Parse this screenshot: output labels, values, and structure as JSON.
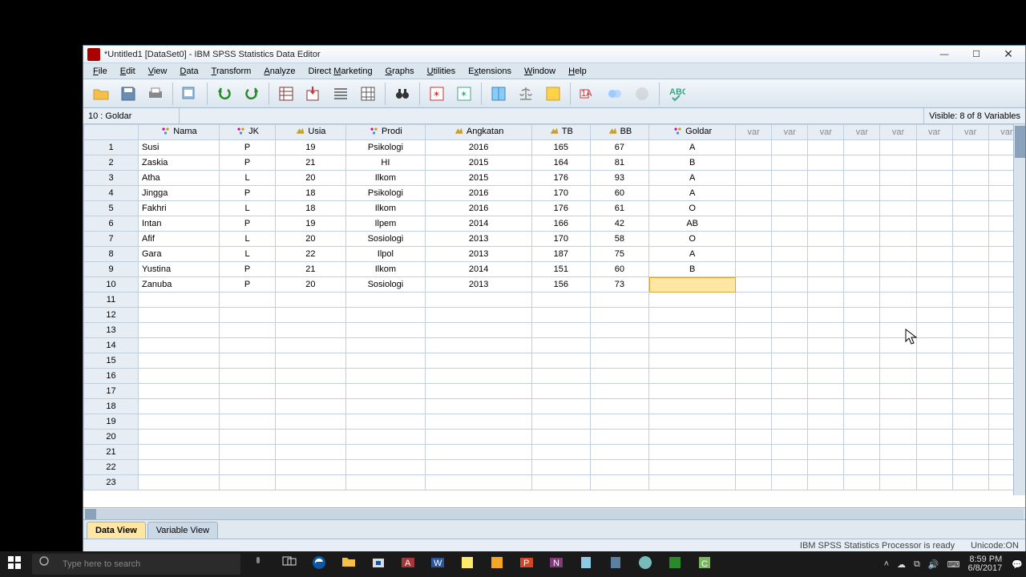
{
  "title": "*Untitled1 [DataSet0] - IBM SPSS Statistics Data Editor",
  "menu": [
    "File",
    "Edit",
    "View",
    "Data",
    "Transform",
    "Analyze",
    "Direct Marketing",
    "Graphs",
    "Utilities",
    "Extensions",
    "Window",
    "Help"
  ],
  "cell_ref": "10 : Goldar",
  "visible_info": "Visible: 8 of 8 Variables",
  "columns": {
    "defined": [
      "Nama",
      "JK",
      "Usia",
      "Prodi",
      "Angkatan",
      "TB",
      "BB",
      "Goldar"
    ],
    "extra_var_label": "var",
    "extra_var_count": 8
  },
  "rows": [
    {
      "n": 1,
      "Nama": "Susi",
      "JK": "P",
      "Usia": "19",
      "Prodi": "Psikologi",
      "Angkatan": "2016",
      "TB": "165",
      "BB": "67",
      "Goldar": "A"
    },
    {
      "n": 2,
      "Nama": "Zaskia",
      "JK": "P",
      "Usia": "21",
      "Prodi": "HI",
      "Angkatan": "2015",
      "TB": "164",
      "BB": "81",
      "Goldar": "B"
    },
    {
      "n": 3,
      "Nama": "Atha",
      "JK": "L",
      "Usia": "20",
      "Prodi": "Ilkom",
      "Angkatan": "2015",
      "TB": "176",
      "BB": "93",
      "Goldar": "A"
    },
    {
      "n": 4,
      "Nama": "Jingga",
      "JK": "P",
      "Usia": "18",
      "Prodi": "Psikologi",
      "Angkatan": "2016",
      "TB": "170",
      "BB": "60",
      "Goldar": "A"
    },
    {
      "n": 5,
      "Nama": "Fakhri",
      "JK": "L",
      "Usia": "18",
      "Prodi": "Ilkom",
      "Angkatan": "2016",
      "TB": "176",
      "BB": "61",
      "Goldar": "O"
    },
    {
      "n": 6,
      "Nama": "Intan",
      "JK": "P",
      "Usia": "19",
      "Prodi": "Ilpem",
      "Angkatan": "2014",
      "TB": "166",
      "BB": "42",
      "Goldar": "AB"
    },
    {
      "n": 7,
      "Nama": "Afif",
      "JK": "L",
      "Usia": "20",
      "Prodi": "Sosiologi",
      "Angkatan": "2013",
      "TB": "170",
      "BB": "58",
      "Goldar": "O"
    },
    {
      "n": 8,
      "Nama": "Gara",
      "JK": "L",
      "Usia": "22",
      "Prodi": "Ilpol",
      "Angkatan": "2013",
      "TB": "187",
      "BB": "75",
      "Goldar": "A"
    },
    {
      "n": 9,
      "Nama": "Yustina",
      "JK": "P",
      "Usia": "21",
      "Prodi": "Ilkom",
      "Angkatan": "2014",
      "TB": "151",
      "BB": "60",
      "Goldar": "B"
    },
    {
      "n": 10,
      "Nama": "Zanuba",
      "JK": "P",
      "Usia": "20",
      "Prodi": "Sosiologi",
      "Angkatan": "2013",
      "TB": "156",
      "BB": "73",
      "Goldar": ""
    }
  ],
  "empty_rows": [
    11,
    12,
    13,
    14,
    15,
    16,
    17,
    18,
    19,
    20,
    21,
    22,
    23
  ],
  "active_cell": {
    "row": 10,
    "col": "Goldar"
  },
  "view_tabs": {
    "data": "Data View",
    "variable": "Variable View",
    "active": "data"
  },
  "status": {
    "processor": "IBM SPSS Statistics Processor is ready",
    "unicode": "Unicode:ON"
  },
  "taskbar": {
    "search_placeholder": "Type here to search",
    "time": "8:59 PM",
    "date": "6/8/2017"
  }
}
